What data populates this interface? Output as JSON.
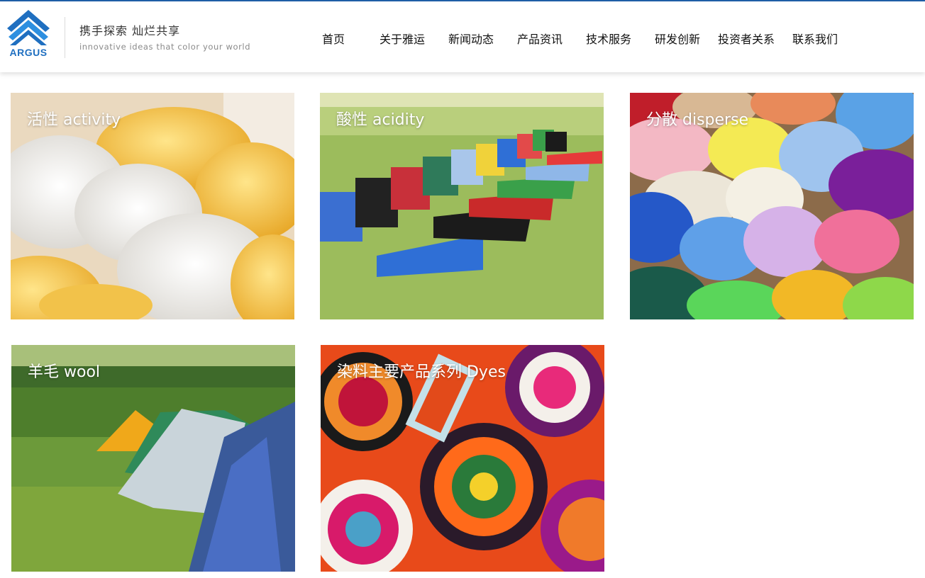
{
  "brand": {
    "logo_text": "ARGUS",
    "slogan": "携手探索  灿烂共享",
    "tagline": "innovative ideas that color your world",
    "accent_color": "#1f6fc0"
  },
  "nav": {
    "items": [
      {
        "label": "首页"
      },
      {
        "label": "关于雅运"
      },
      {
        "label": "新闻动态"
      },
      {
        "label": "产品资讯"
      },
      {
        "label": "技术服务"
      },
      {
        "label": "研发创新"
      },
      {
        "label": "投资者关系"
      },
      {
        "label": "联系我们"
      }
    ]
  },
  "products": [
    {
      "label": "活性 activity",
      "image": "rolled-towels-photo"
    },
    {
      "label": "酸性 acidity",
      "image": "jerseys-on-grass-photo"
    },
    {
      "label": "分散 disperse",
      "image": "colored-wool-rovings-photo"
    },
    {
      "label": "羊毛 wool",
      "image": "tents-on-lawn-photo"
    },
    {
      "label": "染料主要产品系列 Dyes",
      "image": "printed-fabric-pattern-photo"
    }
  ]
}
